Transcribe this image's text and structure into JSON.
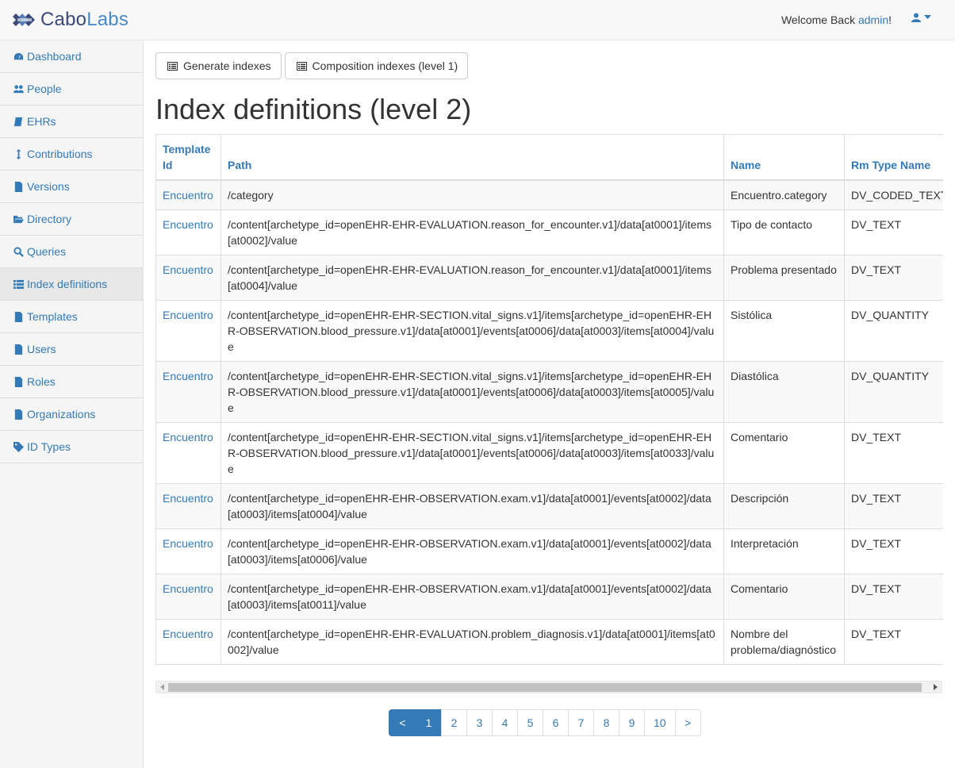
{
  "brand": {
    "part1": "Cabo",
    "part2": "Labs"
  },
  "header": {
    "welcome_prefix": "Welcome Back ",
    "username": "admin",
    "welcome_suffix": "!"
  },
  "sidebar": {
    "items": [
      {
        "label": "Dashboard",
        "icon": "dashboard-icon"
      },
      {
        "label": "People",
        "icon": "users-icon"
      },
      {
        "label": "EHRs",
        "icon": "book-icon"
      },
      {
        "label": "Contributions",
        "icon": "arrows-v-icon"
      },
      {
        "label": "Versions",
        "icon": "file-icon"
      },
      {
        "label": "Directory",
        "icon": "folder-open-icon"
      },
      {
        "label": "Queries",
        "icon": "search-icon"
      },
      {
        "label": "Index definitions",
        "icon": "list-icon"
      },
      {
        "label": "Templates",
        "icon": "file-icon"
      },
      {
        "label": "Users",
        "icon": "file-icon"
      },
      {
        "label": "Roles",
        "icon": "file-icon"
      },
      {
        "label": "Organizations",
        "icon": "file-icon"
      },
      {
        "label": "ID Types",
        "icon": "tag-icon"
      }
    ],
    "active": "Index definitions"
  },
  "toolbar": {
    "generate_label": "Generate indexes",
    "composition_label": "Composition indexes (level 1)"
  },
  "page_title": "Index definitions (level 2)",
  "table": {
    "headers": {
      "template_id": "Template Id",
      "path": "Path",
      "name": "Name",
      "rm_type": "Rm Type Name"
    },
    "rows": [
      {
        "template_id": "Encuentro",
        "path": "/category",
        "name": "Encuentro.category",
        "rm_type": "DV_CODED_TEXT"
      },
      {
        "template_id": "Encuentro",
        "path": "/content[archetype_id=openEHR-EHR-EVALUATION.reason_for_encounter.v1]/data[at0001]/items[at0002]/value",
        "name": "Tipo de contacto",
        "rm_type": "DV_TEXT"
      },
      {
        "template_id": "Encuentro",
        "path": "/content[archetype_id=openEHR-EHR-EVALUATION.reason_for_encounter.v1]/data[at0001]/items[at0004]/value",
        "name": "Problema presentado",
        "rm_type": "DV_TEXT"
      },
      {
        "template_id": "Encuentro",
        "path": "/content[archetype_id=openEHR-EHR-SECTION.vital_signs.v1]/items[archetype_id=openEHR-EHR-OBSERVATION.blood_pressure.v1]/data[at0001]/events[at0006]/data[at0003]/items[at0004]/value",
        "name": "Sistólica",
        "rm_type": "DV_QUANTITY"
      },
      {
        "template_id": "Encuentro",
        "path": "/content[archetype_id=openEHR-EHR-SECTION.vital_signs.v1]/items[archetype_id=openEHR-EHR-OBSERVATION.blood_pressure.v1]/data[at0001]/events[at0006]/data[at0003]/items[at0005]/value",
        "name": "Diastólica",
        "rm_type": "DV_QUANTITY"
      },
      {
        "template_id": "Encuentro",
        "path": "/content[archetype_id=openEHR-EHR-SECTION.vital_signs.v1]/items[archetype_id=openEHR-EHR-OBSERVATION.blood_pressure.v1]/data[at0001]/events[at0006]/data[at0003]/items[at0033]/value",
        "name": "Comentario",
        "rm_type": "DV_TEXT"
      },
      {
        "template_id": "Encuentro",
        "path": "/content[archetype_id=openEHR-EHR-OBSERVATION.exam.v1]/data[at0001]/events[at0002]/data[at0003]/items[at0004]/value",
        "name": "Descripción",
        "rm_type": "DV_TEXT"
      },
      {
        "template_id": "Encuentro",
        "path": "/content[archetype_id=openEHR-EHR-OBSERVATION.exam.v1]/data[at0001]/events[at0002]/data[at0003]/items[at0006]/value",
        "name": "Interpretación",
        "rm_type": "DV_TEXT"
      },
      {
        "template_id": "Encuentro",
        "path": "/content[archetype_id=openEHR-EHR-OBSERVATION.exam.v1]/data[at0001]/events[at0002]/data[at0003]/items[at0011]/value",
        "name": "Comentario",
        "rm_type": "DV_TEXT"
      },
      {
        "template_id": "Encuentro",
        "path": "/content[archetype_id=openEHR-EHR-EVALUATION.problem_diagnosis.v1]/data[at0001]/items[at0002]/value",
        "name": "Nombre del problema/diagnóstico",
        "rm_type": "DV_TEXT"
      }
    ]
  },
  "pagination": {
    "prev": "<",
    "next": ">",
    "pages": [
      "1",
      "2",
      "3",
      "4",
      "5",
      "6",
      "7",
      "8",
      "9",
      "10"
    ],
    "current": "1"
  },
  "colors": {
    "link": "#337ab7",
    "brand_dark": "#3b4a78",
    "brand_light": "#4a8ac8"
  }
}
